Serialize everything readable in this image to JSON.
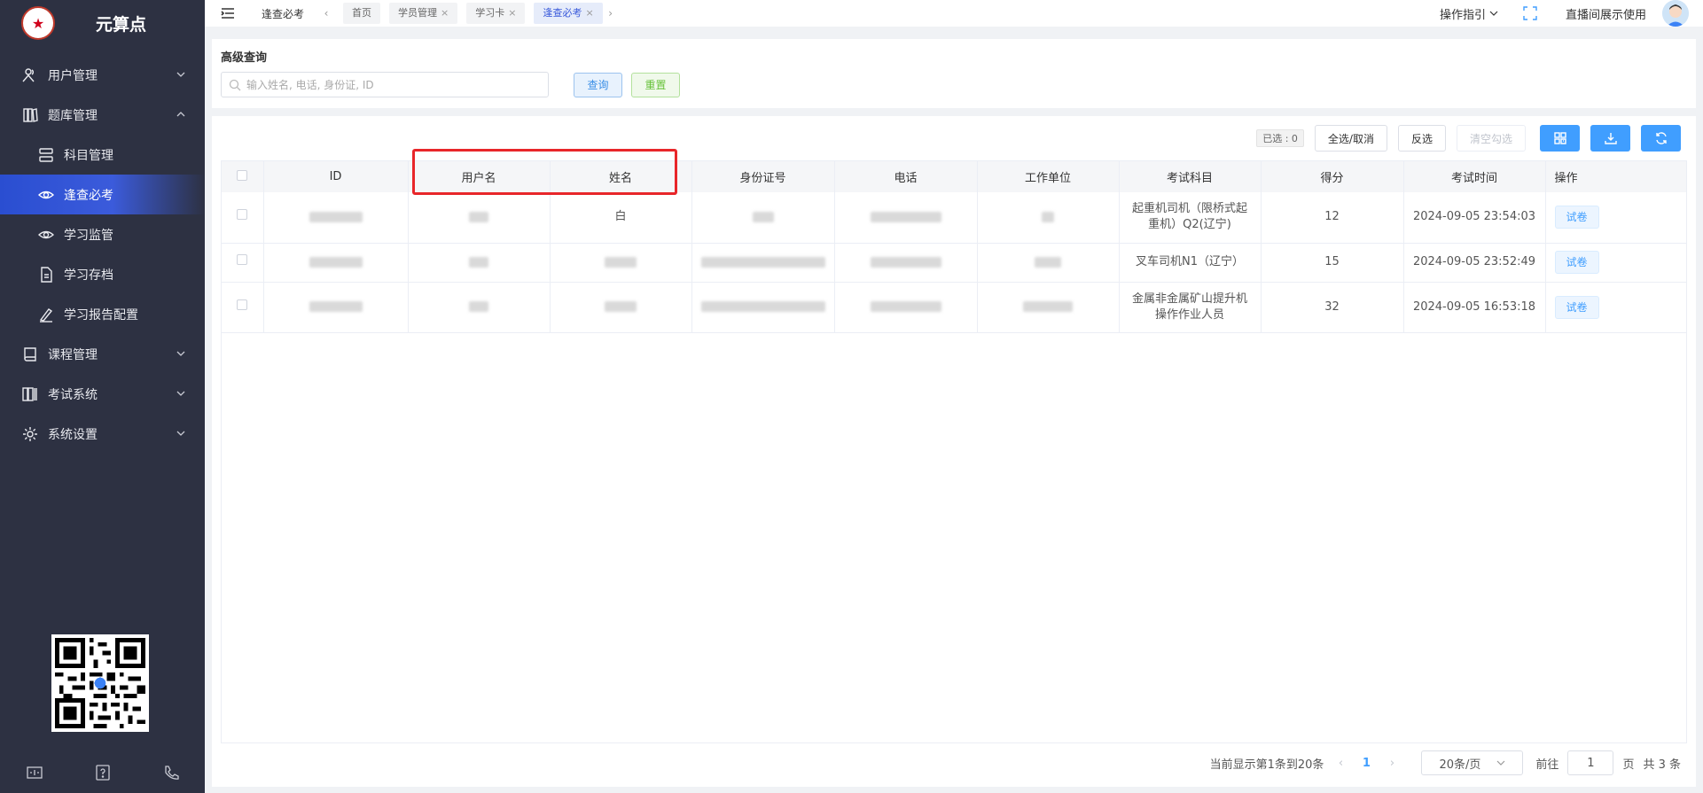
{
  "sidebar": {
    "logo_text": "元算点",
    "menu": [
      {
        "label": "用户管理",
        "icon": "users-icon",
        "sub": false,
        "expanded": false
      },
      {
        "label": "题库管理",
        "icon": "library-icon",
        "sub": false,
        "expanded": true
      },
      {
        "label": "科目管理",
        "icon": "server-icon",
        "sub": true
      },
      {
        "label": "逢查必考",
        "icon": "eye-icon",
        "sub": true,
        "active": true
      },
      {
        "label": "学习监管",
        "icon": "eye-icon",
        "sub": true
      },
      {
        "label": "学习存档",
        "icon": "file-icon",
        "sub": true
      },
      {
        "label": "学习报告配置",
        "icon": "pen-icon",
        "sub": true
      },
      {
        "label": "课程管理",
        "icon": "book-icon",
        "sub": false,
        "expanded": false
      },
      {
        "label": "考试系统",
        "icon": "exam-icon",
        "sub": false,
        "expanded": false
      },
      {
        "label": "系统设置",
        "icon": "gear-icon",
        "sub": false,
        "expanded": false
      }
    ]
  },
  "topbar": {
    "current_title": "逢查必考",
    "tabs": [
      {
        "label": "首页",
        "closable": false,
        "active": false
      },
      {
        "label": "学员管理",
        "closable": true,
        "active": false
      },
      {
        "label": "学习卡",
        "closable": true,
        "active": false
      },
      {
        "label": "逢查必考",
        "closable": true,
        "active": true
      }
    ],
    "guide_label": "操作指引",
    "user_label": "直播间展示使用"
  },
  "search": {
    "title": "高级查询",
    "placeholder": "输入姓名, 电话, 身份证, ID",
    "query_label": "查询",
    "reset_label": "重置"
  },
  "toolbar": {
    "selected_label": "已选 : 0",
    "select_all_label": "全选/取消",
    "invert_label": "反选",
    "clear_label": "清空勾选"
  },
  "table": {
    "columns": [
      "ID",
      "用户名",
      "姓名",
      "身份证号",
      "电话",
      "工作单位",
      "考试科目",
      "得分",
      "考试时间",
      "操作"
    ],
    "rows": [
      {
        "name": "白",
        "subject": "起重机司机（限桥式起重机）Q2(辽宁)",
        "score": "12",
        "time": "2024-09-05 23:54:03",
        "action": "试卷"
      },
      {
        "name": "",
        "subject": "叉车司机N1（辽宁）",
        "score": "15",
        "time": "2024-09-05 23:52:49",
        "action": "试卷"
      },
      {
        "name": "",
        "subject": "金属非金属矿山提升机操作作业人员",
        "score": "32",
        "time": "2024-09-05 16:53:18",
        "action": "试卷"
      }
    ]
  },
  "pagination": {
    "summary": "当前显示第1条到20条",
    "current_page": "1",
    "page_size": "20条/页",
    "goto_label": "前往",
    "goto_value": "1",
    "page_unit": "页",
    "total": "共 3 条"
  },
  "colors": {
    "sidebar_bg": "#2d3142",
    "accent": "#3b5bdb",
    "primary": "#409eff",
    "highlight": "#e8262a"
  }
}
